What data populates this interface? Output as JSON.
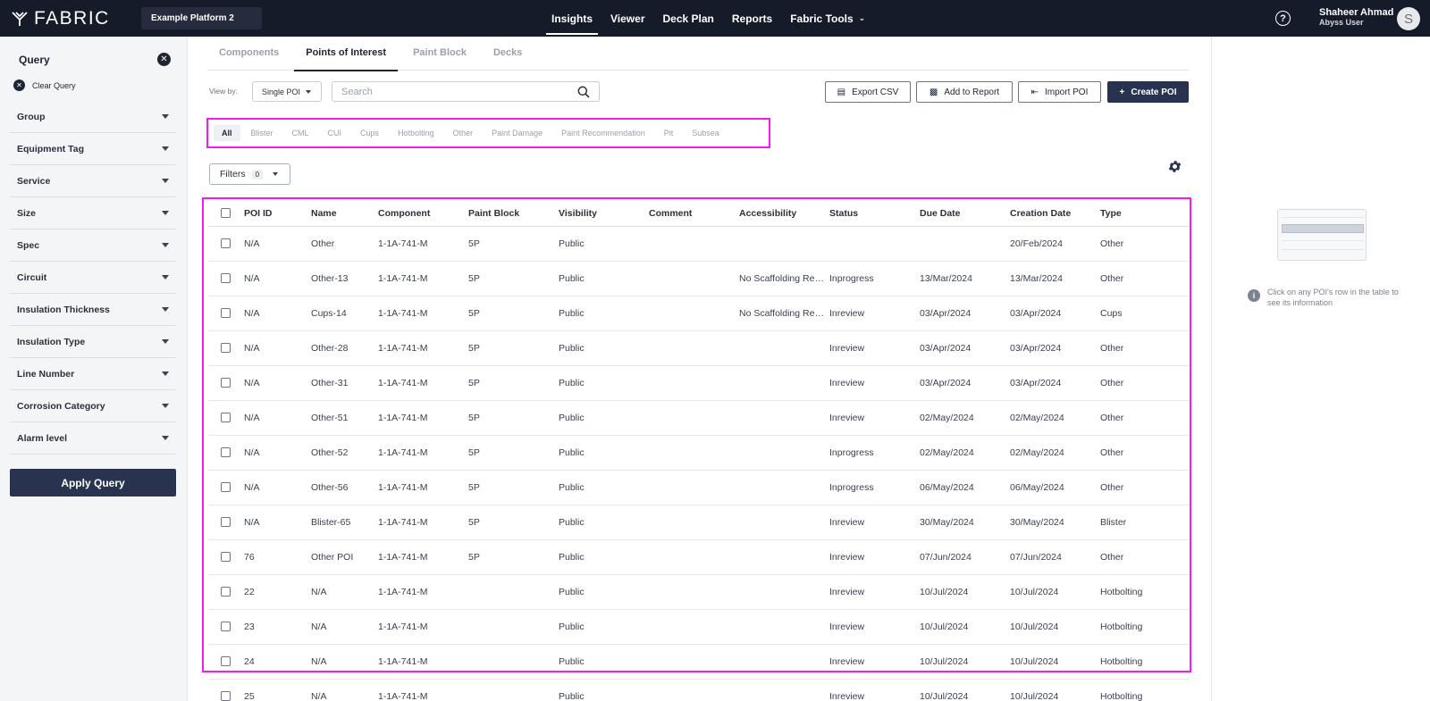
{
  "app": {
    "logo_text": "FABRIC",
    "platform": "Example Platform 2",
    "nav": [
      {
        "label": "Insights",
        "active": true
      },
      {
        "label": "Viewer",
        "active": false
      },
      {
        "label": "Deck Plan",
        "active": false
      },
      {
        "label": "Reports",
        "active": false
      },
      {
        "label": "Fabric Tools",
        "active": false
      }
    ],
    "user": {
      "name": "Shaheer Ahmad",
      "role": "Abyss User",
      "initial": "S"
    }
  },
  "sidebar": {
    "title": "Query",
    "clear_label": "Clear Query",
    "filters": [
      "Group",
      "Equipment Tag",
      "Service",
      "Size",
      "Spec",
      "Circuit",
      "Insulation Thickness",
      "Insulation Type",
      "Line Number",
      "Corrosion Category",
      "Alarm level"
    ],
    "apply_label": "Apply Query"
  },
  "tabs": [
    "Components",
    "Points of Interest",
    "Paint Block",
    "Decks"
  ],
  "toolbar": {
    "view_by_label": "View by:",
    "view_by_value": "Single POI",
    "search_placeholder": "Search",
    "export_label": "Export CSV",
    "add_report_label": "Add to Report",
    "import_label": "Import POI",
    "create_label": "Create POI"
  },
  "types": [
    "All",
    "Blister",
    "CML",
    "CUI",
    "Cups",
    "Hotbolting",
    "Other",
    "Paint Damage",
    "Paint Recommendation",
    "Pit",
    "Subsea"
  ],
  "filters": {
    "label": "Filters",
    "count": "0"
  },
  "table": {
    "columns": [
      "POI ID",
      "Name",
      "Component",
      "Paint Block",
      "Visibility",
      "Comment",
      "Accessibility",
      "Status",
      "Due Date",
      "Creation Date",
      "Type"
    ],
    "rows": [
      [
        "N/A",
        "Other",
        "1-1A-741-M",
        "5P",
        "Public",
        "",
        "",
        "",
        "",
        "20/Feb/2024",
        "Other"
      ],
      [
        "N/A",
        "Other-13",
        "1-1A-741-M",
        "5P",
        "Public",
        "",
        "No Scaffolding Required",
        "Inprogress",
        "13/Mar/2024",
        "13/Mar/2024",
        "Other"
      ],
      [
        "N/A",
        "Cups-14",
        "1-1A-741-M",
        "5P",
        "Public",
        "",
        "No Scaffolding Required",
        "Inreview",
        "03/Apr/2024",
        "03/Apr/2024",
        "Cups"
      ],
      [
        "N/A",
        "Other-28",
        "1-1A-741-M",
        "5P",
        "Public",
        "",
        "",
        "Inreview",
        "03/Apr/2024",
        "03/Apr/2024",
        "Other"
      ],
      [
        "N/A",
        "Other-31",
        "1-1A-741-M",
        "5P",
        "Public",
        "",
        "",
        "Inreview",
        "03/Apr/2024",
        "03/Apr/2024",
        "Other"
      ],
      [
        "N/A",
        "Other-51",
        "1-1A-741-M",
        "5P",
        "Public",
        "",
        "",
        "Inreview",
        "02/May/2024",
        "02/May/2024",
        "Other"
      ],
      [
        "N/A",
        "Other-52",
        "1-1A-741-M",
        "5P",
        "Public",
        "",
        "",
        "Inprogress",
        "02/May/2024",
        "02/May/2024",
        "Other"
      ],
      [
        "N/A",
        "Other-56",
        "1-1A-741-M",
        "5P",
        "Public",
        "",
        "",
        "Inprogress",
        "06/May/2024",
        "06/May/2024",
        "Other"
      ],
      [
        "N/A",
        "Blister-65",
        "1-1A-741-M",
        "5P",
        "Public",
        "",
        "",
        "Inreview",
        "30/May/2024",
        "30/May/2024",
        "Blister"
      ],
      [
        "76",
        "Other POI",
        "1-1A-741-M",
        "5P",
        "Public",
        "",
        "",
        "Inreview",
        "07/Jun/2024",
        "07/Jun/2024",
        "Other"
      ],
      [
        "22",
        "N/A",
        "1-1A-741-M",
        "",
        "Public",
        "",
        "",
        "Inreview",
        "10/Jul/2024",
        "10/Jul/2024",
        "Hotbolting"
      ],
      [
        "23",
        "N/A",
        "1-1A-741-M",
        "",
        "Public",
        "",
        "",
        "Inreview",
        "10/Jul/2024",
        "10/Jul/2024",
        "Hotbolting"
      ],
      [
        "24",
        "N/A",
        "1-1A-741-M",
        "",
        "Public",
        "",
        "",
        "Inreview",
        "10/Jul/2024",
        "10/Jul/2024",
        "Hotbolting"
      ],
      [
        "25",
        "N/A",
        "1-1A-741-M",
        "",
        "Public",
        "",
        "",
        "Inreview",
        "10/Jul/2024",
        "10/Jul/2024",
        "Hotbolting"
      ]
    ]
  },
  "right_panel": {
    "hint": "Click on any POI's row in the table to see its information"
  },
  "colors": {
    "topbar": "#161b29",
    "primary": "#283350",
    "highlight": "#f21cf0"
  }
}
